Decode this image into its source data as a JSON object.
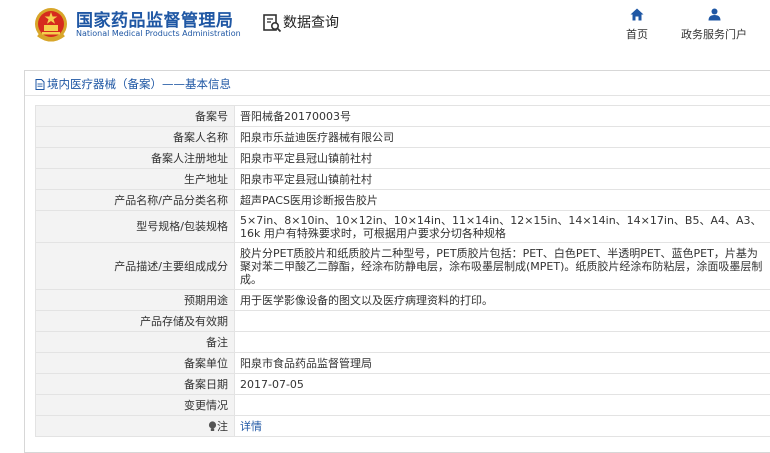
{
  "header": {
    "org_name_cn": "国家药品监督管理局",
    "org_name_en": "National Medical Products Administration",
    "query_label": "数据查询",
    "nav": {
      "home_label": "首页",
      "service_label": "政务服务门户"
    }
  },
  "breadcrumb": "境内医疗器械（备案）——基本信息",
  "fields": [
    {
      "label": "备案号",
      "value": "晋阳械备20170003号"
    },
    {
      "label": "备案人名称",
      "value": "阳泉市乐益迪医疗器械有限公司"
    },
    {
      "label": "备案人注册地址",
      "value": "阳泉市平定县冠山镇前社村"
    },
    {
      "label": "生产地址",
      "value": "阳泉市平定县冠山镇前社村"
    },
    {
      "label": "产品名称/产品分类名称",
      "value": "超声PACS医用诊断报告胶片"
    },
    {
      "label": "型号规格/包装规格",
      "value": "5×7in、8×10in、10×12in、10×14in、11×14in、12×15in、14×14in、14×17in、B5、A4、A3、16k 用户有特殊要求时，可根据用户要求分切各种规格"
    },
    {
      "label": "产品描述/主要组成成分",
      "value": "胶片分PET质胶片和纸质胶片二种型号，PET质胶片包括：PET、白色PET、半透明PET、蓝色PET，片基为聚对苯二甲酸乙二醇酯，经涂布防静电层，涂布吸墨层制成(MPET)。纸质胶片经涂布防粘层，涂面吸墨层制成。"
    },
    {
      "label": "预期用途",
      "value": "用于医学影像设备的图文以及医疗病理资料的打印。"
    },
    {
      "label": "产品存储及有效期",
      "value": ""
    },
    {
      "label": "备注",
      "value": ""
    },
    {
      "label": "备案单位",
      "value": "阳泉市食品药品监督管理局"
    },
    {
      "label": "备案日期",
      "value": "2017-07-05"
    },
    {
      "label": "变更情况",
      "value": ""
    }
  ],
  "note_row": {
    "label": "注",
    "link_text": "详情"
  },
  "colors": {
    "brand": "#1f57a4",
    "label_bg": "#f3f3f3",
    "border": "#e3e3e3"
  }
}
